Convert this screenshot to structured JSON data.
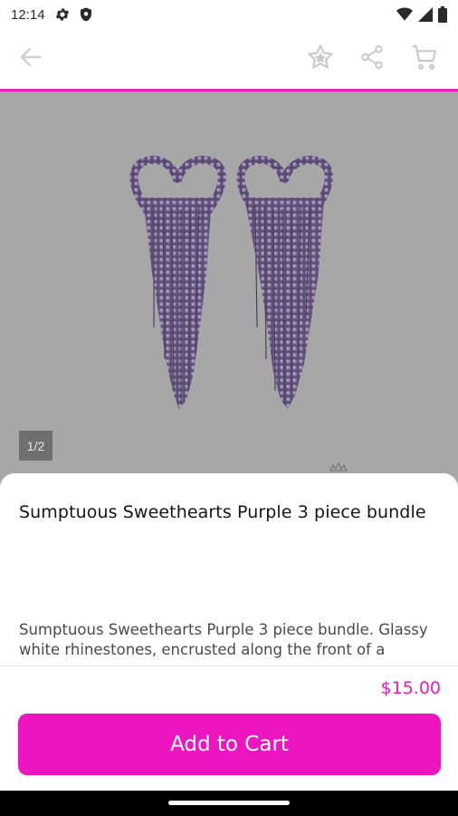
{
  "status_bar": {
    "time": "12:14",
    "icons": [
      "settings-icon",
      "shield-icon",
      "wifi-icon",
      "signal-icon",
      "battery-icon"
    ]
  },
  "app_bar": {
    "back_icon": "arrow-left-icon",
    "favorite_icon": "star-icon",
    "share_icon": "share-icon",
    "cart_icon": "cart-icon",
    "accent_color": "#e61fb5"
  },
  "gallery": {
    "counter": "1/2",
    "background": "#a7a7a8",
    "image_description_icon": "earrings-image"
  },
  "product": {
    "title": "Sumptuous Sweethearts Purple 3 piece bundle",
    "description": "Sumptuous Sweethearts Purple 3 piece bundle. Glassy white rhinestones, encrusted along the front of a",
    "price": "$15.00"
  },
  "actions": {
    "add_to_cart": "Add to Cart",
    "button_color": "#ec16c0"
  }
}
